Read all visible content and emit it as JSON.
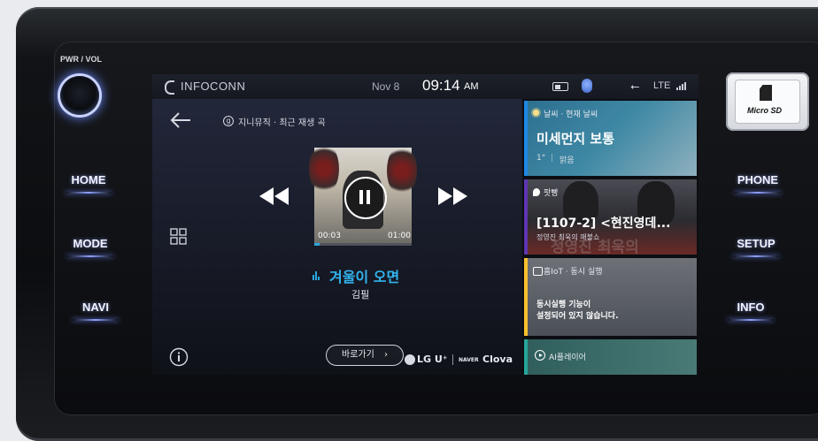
{
  "hardware": {
    "pwr_vol_label": "PWR / VOL",
    "left_buttons": [
      "HOME",
      "MODE",
      "NAVI"
    ],
    "right_buttons": [
      "PHONE",
      "SETUP",
      "INFO"
    ],
    "sd_label": "Micro SD"
  },
  "status_bar": {
    "brand": "INFOCONN",
    "date": "Nov 8",
    "time": "09:14",
    "ampm": "AM",
    "network": "LTE"
  },
  "player": {
    "source": "지니뮤직 · 최근 재생 곡",
    "song_title": "겨울이 오면",
    "artist": "김필",
    "elapsed": "00:03",
    "duration": "01:00",
    "progress": 0.05,
    "goto_label": "바로가기",
    "partners": {
      "lg": "LG U⁺",
      "naver": "NAVER",
      "clova": "Clova"
    }
  },
  "cards": {
    "weather": {
      "title": "날씨 · 현재 날씨",
      "headline": "미세먼지 보통",
      "detail_temp": "1°",
      "detail_state": "맑음",
      "accent": "#1e88e5"
    },
    "podcast": {
      "title": "팟빵",
      "headline": "[1107-2] <현진영데...",
      "detail": "정영진 최욱의 매불쇼",
      "poster_text": "정영진 최욱의",
      "accent": "#5e35b1"
    },
    "iot": {
      "title": "홈IoT · 동시 실행",
      "line1": "동시실행 기능이",
      "line2": "설정되어 있지 않습니다.",
      "accent": "#fbc02d"
    },
    "ai": {
      "title": "AI플레이어",
      "accent": "#26a69a"
    }
  }
}
